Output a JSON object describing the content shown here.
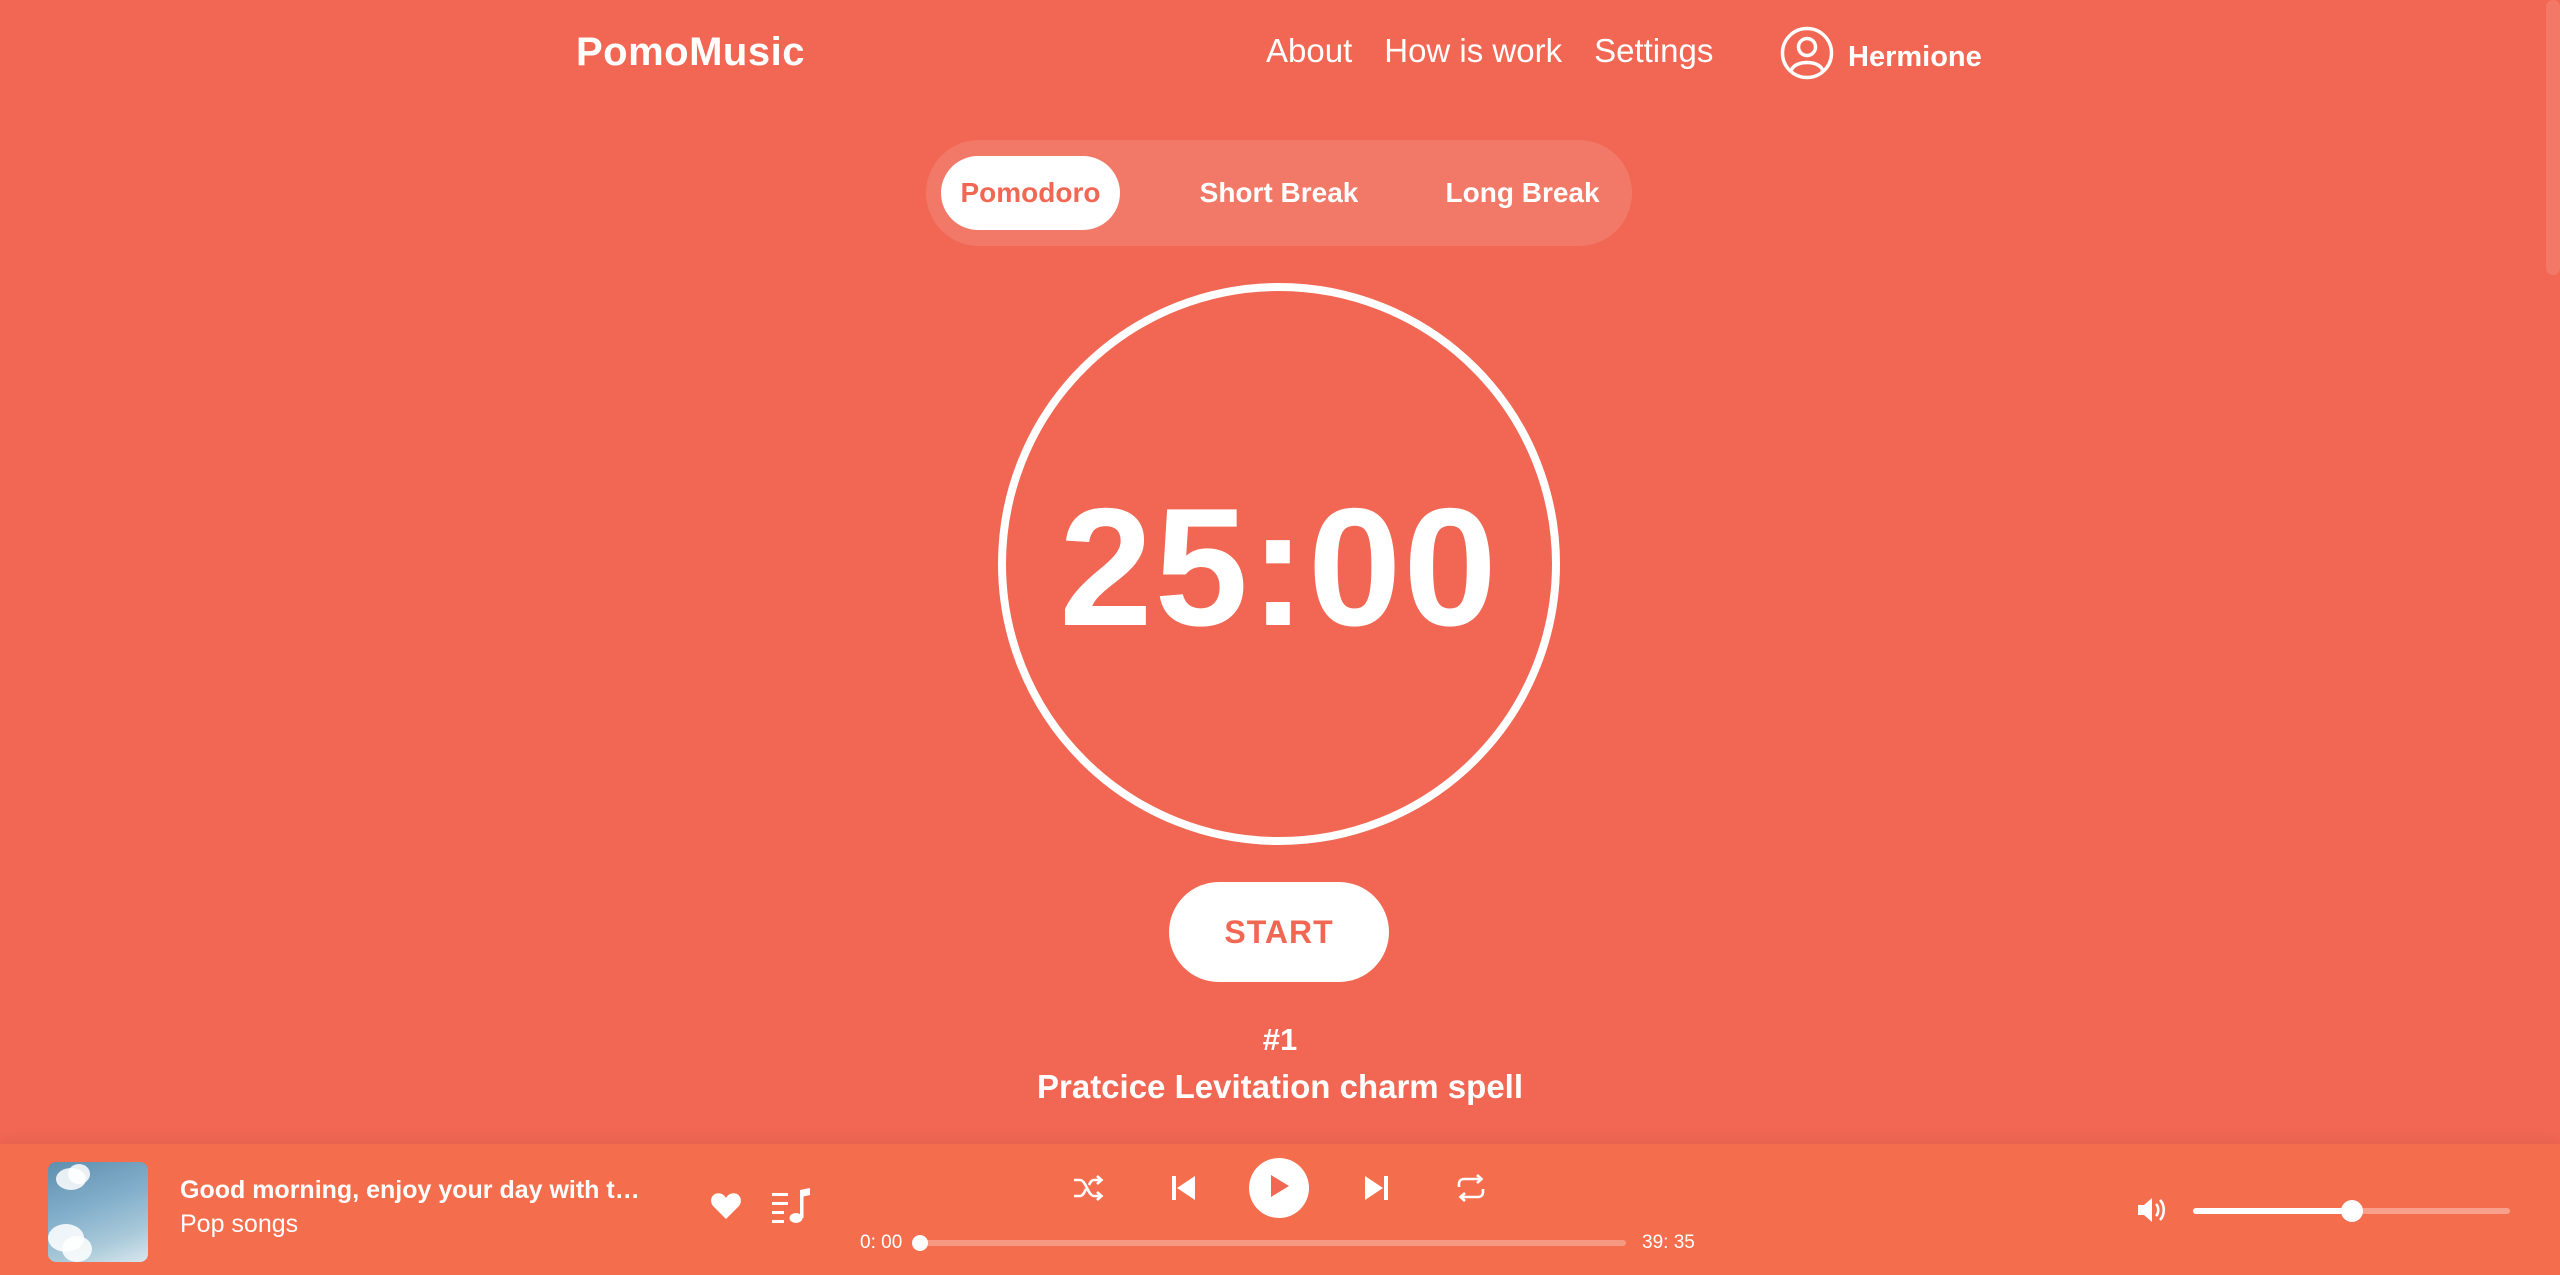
{
  "header": {
    "logo": "PomoMusic",
    "nav": [
      "About",
      "How is work",
      "Settings"
    ],
    "user_name": "Hermione"
  },
  "modes": {
    "tabs": [
      "Pomodoro",
      "Short Break",
      "Long Break"
    ],
    "active": "Pomodoro"
  },
  "timer": {
    "time": "25:00",
    "start_label": "START"
  },
  "task": {
    "number": "#1",
    "name": "Pratcice Levitation charm spell"
  },
  "player": {
    "track_title": "Good morning, enjoy your day with this playlist",
    "track_subtitle": "Pop songs",
    "current_time": "0: 00",
    "total_time": "39: 35",
    "progress": 0,
    "volume": 0.5
  },
  "colors": {
    "background": "#f16753",
    "player_bar": "#f46e4d",
    "accent_text": "#f16753",
    "foreground": "#ffffff"
  },
  "icons": {
    "user": "user-circle-icon",
    "like": "heart-icon",
    "playlist": "playlist-music-icon",
    "shuffle": "shuffle-icon",
    "prev": "skip-previous-icon",
    "play": "play-icon",
    "next": "skip-next-icon",
    "repeat": "repeat-icon",
    "volume": "volume-icon"
  }
}
